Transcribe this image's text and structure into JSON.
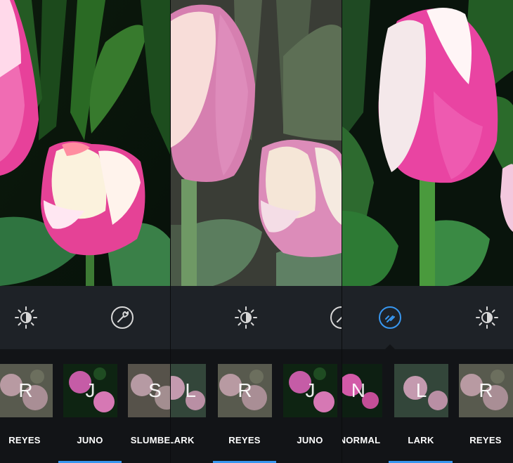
{
  "colors": {
    "accent": "#3897f0",
    "tool_bg": "#1e2227",
    "strip_bg": "#121417",
    "text": "#ffffff",
    "icon": "#d7d7d7"
  },
  "screens": [
    {
      "tools": [
        {
          "icon": "brightness-icon"
        },
        {
          "icon": "wrench-icon"
        }
      ],
      "filters": [
        {
          "letter": "R",
          "label": "REYES"
        },
        {
          "letter": "J",
          "label": "JUNO",
          "selected": true
        },
        {
          "letter": "S",
          "label": "SLUMBER"
        }
      ]
    },
    {
      "tools": [
        {
          "icon": "brightness-icon"
        },
        {
          "icon": "wrench-icon"
        }
      ],
      "filters": [
        {
          "letter": "L",
          "label": "LARK"
        },
        {
          "letter": "R",
          "label": "REYES",
          "selected": true
        },
        {
          "letter": "J",
          "label": "JUNO"
        }
      ]
    },
    {
      "tools": [
        {
          "icon": "filter-active-icon",
          "active": true
        },
        {
          "icon": "brightness-icon"
        }
      ],
      "filters": [
        {
          "letter": "N",
          "label": "NORMAL"
        },
        {
          "letter": "L",
          "label": "LARK",
          "selected": true
        },
        {
          "letter": "R",
          "label": "REYES"
        }
      ]
    }
  ]
}
